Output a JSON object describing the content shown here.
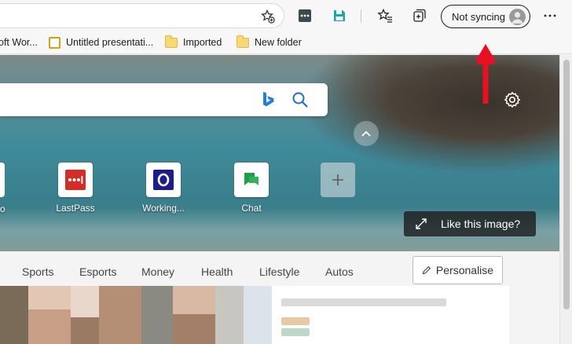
{
  "toolbar": {
    "profile_label": "Not syncing",
    "icons": [
      "add-favorite-icon",
      "lastpass-extension-icon",
      "save-extension-icon",
      "favorites-icon",
      "collections-icon",
      "more-icon"
    ]
  },
  "favorites_bar": {
    "items": [
      {
        "label": "oft Wor...",
        "icon": "word-icon"
      },
      {
        "label": "Untitled presentati...",
        "icon": "slides-icon"
      },
      {
        "label": "Imported",
        "icon": "folder-icon"
      },
      {
        "label": "New folder",
        "icon": "folder-icon"
      }
    ]
  },
  "newtab": {
    "quick_links": [
      {
        "label": "o"
      },
      {
        "label": "LastPass"
      },
      {
        "label": "Working..."
      },
      {
        "label": "Chat"
      }
    ],
    "like_image_label": "Like this image?"
  },
  "feed": {
    "nav": [
      "Sports",
      "Esports",
      "Money",
      "Health",
      "Lifestyle",
      "Autos"
    ],
    "personalise_label": "Personalise"
  },
  "colors": {
    "accent": "#e81123",
    "lastpass": "#d32d27",
    "outlook": "#1e1b8a",
    "chat": "#1e9e4a"
  }
}
